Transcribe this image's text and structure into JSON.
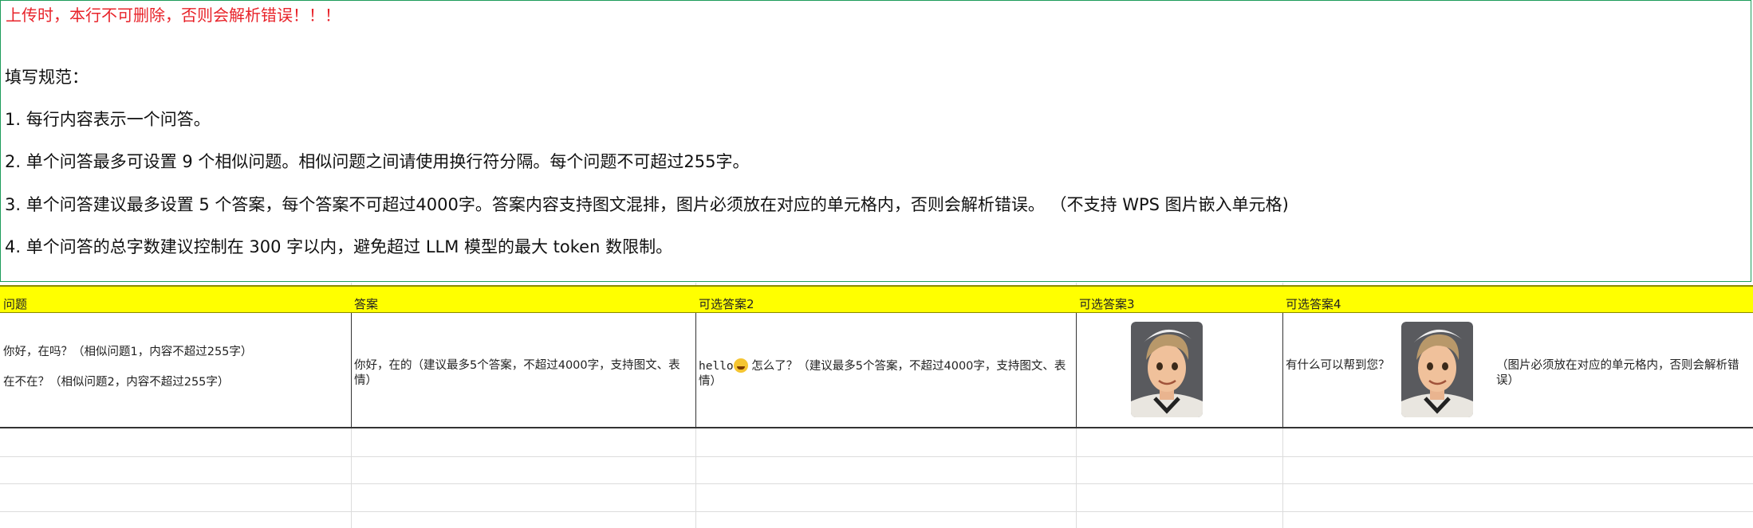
{
  "notice": {
    "warning": "上传时，本行不可删除，否则会解析错误！！！",
    "title": "填写规范：",
    "rules": [
      "1. 每行内容表示一个问答。",
      "2. 单个问答最多可设置 9 个相似问题。相似问题之间请使用换行符分隔。每个问题不可超过255字。",
      "3. 单个问答建议最多设置 5 个答案，每个答案不可超过4000字。答案内容支持图文混排，图片必须放在对应的单元格内，否则会解析错误。 （不支持 WPS 图片嵌入单元格)",
      "4. 单个问答的总字数建议控制在 300 字以内，避免超过 LLM 模型的最大 token 数限制。"
    ]
  },
  "table": {
    "headers": [
      "问题",
      "答案",
      "可选答案2",
      "可选答案3",
      "可选答案4"
    ],
    "row": {
      "q1": "你好，在吗？（相似问题1，内容不超过255字）",
      "q2": "在不在？（相似问题2，内容不超过255字）",
      "answer": "你好，在的（建议最多5个答案，不超过4000字，支持图文、表情）",
      "alt2_prefix": "hello",
      "alt2_rest": " 怎么了？（建议最多5个答案，不超过4000字，支持图文、表情）",
      "alt4_text": "有什么可以帮到您？",
      "alt4_note": "（图片必须放在对应的单元格内，否则会解析错误）",
      "emoji_icon": "grinning-face-emoji",
      "image_icon": "cartoon-boy-avatar"
    }
  },
  "colors": {
    "header_bg": "#ffff00",
    "warning": "#e8232a",
    "frame": "#1e9c5a"
  }
}
